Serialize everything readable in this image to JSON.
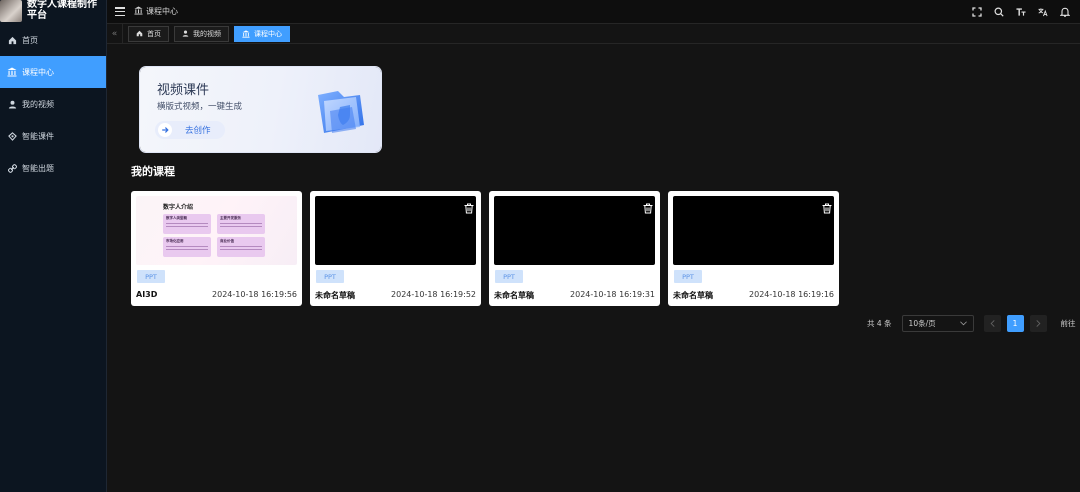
{
  "app": {
    "brand_title": "数字人课程制作平台"
  },
  "sidebar": {
    "items": [
      {
        "label": "首页",
        "icon": "home-icon",
        "active": false
      },
      {
        "label": "课程中心",
        "icon": "bank-icon",
        "active": true
      },
      {
        "label": "我的视频",
        "icon": "user-icon",
        "active": false
      },
      {
        "label": "智能课件",
        "icon": "bulb-icon",
        "active": false
      },
      {
        "label": "智能出题",
        "icon": "link-icon",
        "active": false
      }
    ]
  },
  "header": {
    "breadcrumb": "课程中心"
  },
  "tags": [
    {
      "label": "首页",
      "icon": "home-icon",
      "active": false
    },
    {
      "label": "我的视频",
      "icon": "user-icon",
      "active": false
    },
    {
      "label": "课程中心",
      "icon": "bank-icon",
      "active": true
    }
  ],
  "hero": {
    "title": "视频课件",
    "subtitle": "横版式视频，一键生成",
    "button_label": "去创作"
  },
  "section": {
    "title": "我的课程"
  },
  "ppt_preview": {
    "title": "数字人介绍",
    "boxes": [
      "数字人类型概",
      "主要开发服务",
      "市场化应用",
      "商业价值"
    ]
  },
  "courses": [
    {
      "name": "AI3D",
      "time": "2024-10-18 16:19:56",
      "badge": "PPT",
      "thumb": "ppt"
    },
    {
      "name": "未命名草稿",
      "time": "2024-10-18 16:19:52",
      "badge": "PPT",
      "thumb": "black"
    },
    {
      "name": "未命名草稿",
      "time": "2024-10-18 16:19:31",
      "badge": "PPT",
      "thumb": "black"
    },
    {
      "name": "未命名草稿",
      "time": "2024-10-18 16:19:16",
      "badge": "PPT",
      "thumb": "black"
    }
  ],
  "pagination": {
    "total_text": "共 4 条",
    "page_size": "10条/页",
    "current_page": "1",
    "goto_label": "前往"
  },
  "colors": {
    "accent": "#409eff",
    "sidebar_bg": "#0c1520",
    "page_bg": "#141414"
  }
}
